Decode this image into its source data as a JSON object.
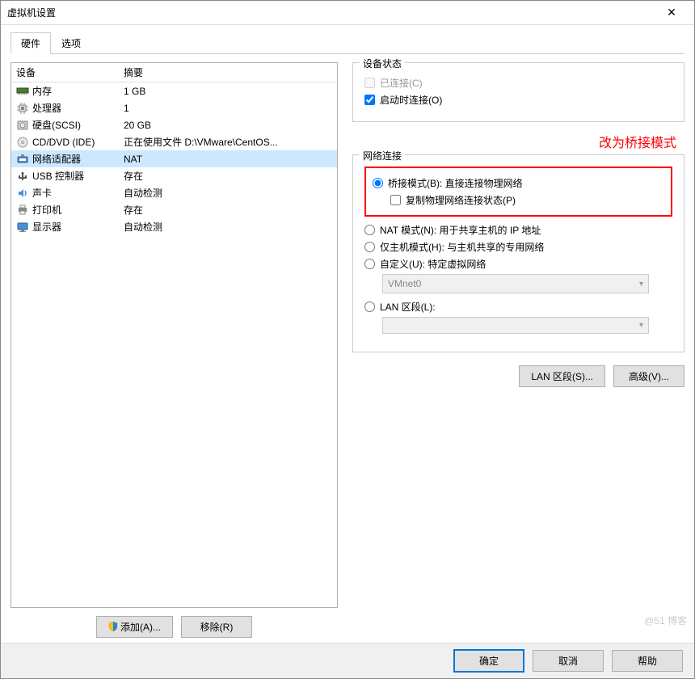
{
  "window": {
    "title": "虚拟机设置"
  },
  "tabs": {
    "hardware": "硬件",
    "options": "选项"
  },
  "list": {
    "header_device": "设备",
    "header_summary": "摘要",
    "rows": [
      {
        "icon": "memory",
        "name": "内存",
        "summary": "1 GB"
      },
      {
        "icon": "cpu",
        "name": "处理器",
        "summary": "1"
      },
      {
        "icon": "hdd",
        "name": "硬盘(SCSI)",
        "summary": "20 GB"
      },
      {
        "icon": "cd",
        "name": "CD/DVD (IDE)",
        "summary": "正在使用文件 D:\\VMware\\CentOS..."
      },
      {
        "icon": "net",
        "name": "网络适配器",
        "summary": "NAT",
        "selected": true
      },
      {
        "icon": "usb",
        "name": "USB 控制器",
        "summary": "存在"
      },
      {
        "icon": "sound",
        "name": "声卡",
        "summary": "自动检测"
      },
      {
        "icon": "printer",
        "name": "打印机",
        "summary": "存在"
      },
      {
        "icon": "monitor",
        "name": "显示器",
        "summary": "自动检测"
      }
    ]
  },
  "left_buttons": {
    "add": "添加(A)...",
    "remove": "移除(R)"
  },
  "device_status": {
    "group_title": "设备状态",
    "connected": "已连接(C)",
    "connect_at_power_on": "启动时连接(O)"
  },
  "annotation": "改为桥接模式",
  "network": {
    "group_title": "网络连接",
    "bridged": "桥接模式(B): 直接连接物理网络",
    "replicate": "复制物理网络连接状态(P)",
    "nat": "NAT 模式(N): 用于共享主机的 IP 地址",
    "host_only": "仅主机模式(H): 与主机共享的专用网络",
    "custom": "自定义(U): 特定虚拟网络",
    "custom_value": "VMnet0",
    "lan_segment": "LAN 区段(L):",
    "lan_value": ""
  },
  "right_buttons": {
    "lan_segments": "LAN 区段(S)...",
    "advanced": "高级(V)..."
  },
  "footer": {
    "ok": "确定",
    "cancel": "取消",
    "help": "帮助"
  },
  "watermark": "@51   博客"
}
